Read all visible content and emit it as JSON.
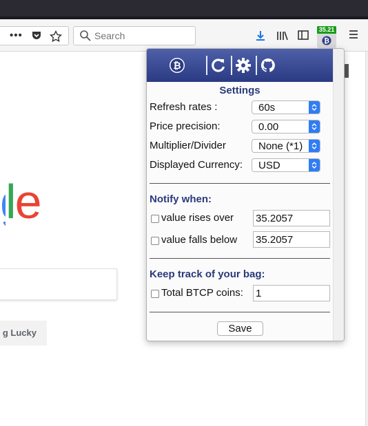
{
  "browser": {
    "search_placeholder": "Search",
    "extension_badge": "35.21"
  },
  "page": {
    "logo_partial": "gle",
    "lucky_button": "g Lucky"
  },
  "popup": {
    "title": "Settings",
    "rows": [
      {
        "label": "Refresh rates :",
        "value": "60s"
      },
      {
        "label": "Price precision:",
        "value": "0.00"
      },
      {
        "label": "Multiplier/Divider",
        "value": "None (*1)"
      },
      {
        "label": "Displayed Currency:",
        "value": "USD"
      }
    ],
    "notify": {
      "heading": "Notify when:",
      "rises_label": "value rises over",
      "rises_value": "35.2057",
      "falls_label": "value falls below",
      "falls_value": "35.2057"
    },
    "bag": {
      "heading": "Keep track of your bag:",
      "coins_label": "Total BTCP coins:",
      "coins_value": "1"
    },
    "save_label": "Save"
  },
  "icons": {
    "header": [
      "bitcoin-private-icon",
      "refresh-icon",
      "gear-icon",
      "github-icon"
    ],
    "toolbar": [
      "more-icon",
      "pocket-icon",
      "bookmark-star-icon",
      "download-icon",
      "library-icon",
      "sidebar-icon",
      "menu-icon"
    ]
  },
  "colors": {
    "header_top": "#4e60a8",
    "header_bottom": "#2a3a83",
    "section_title": "#2a3a7a",
    "badge": "#1a9c1a",
    "select_arrow": "#2f7cf6"
  }
}
